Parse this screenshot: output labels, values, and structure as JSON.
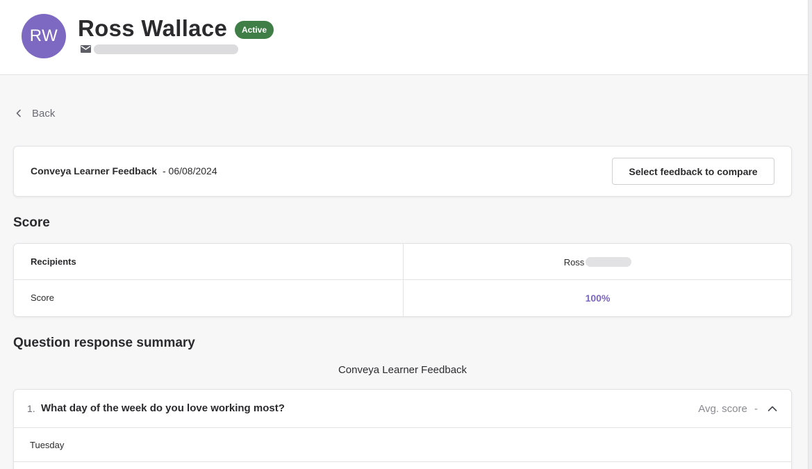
{
  "user": {
    "initials": "RW",
    "name": "Ross Wallace",
    "status": "Active"
  },
  "nav": {
    "back_label": "Back"
  },
  "feedback": {
    "name": "Conveya Learner Feedback",
    "date_separator": "- 06/08/2024",
    "compare_label": "Select feedback to compare"
  },
  "score_section": {
    "title": "Score",
    "rows": [
      {
        "label": "Recipients",
        "value": "Ross"
      },
      {
        "label": "Score",
        "value": "100%"
      }
    ]
  },
  "summary": {
    "title": "Question response summary",
    "subtitle": "Conveya Learner Feedback",
    "questions": [
      {
        "number": "1.",
        "text": "What day of the week do you love working most?",
        "avg_label": "Avg. score",
        "avg_value": "-",
        "answers": [
          "Tuesday"
        ]
      }
    ]
  },
  "icons": {
    "mail": "mail-icon",
    "back": "chevron-left-icon",
    "collapse": "chevron-up-icon"
  },
  "colors": {
    "avatar": "#7d69c2",
    "status_badge": "#3f7f47",
    "score_accent": "#7b67bf"
  }
}
